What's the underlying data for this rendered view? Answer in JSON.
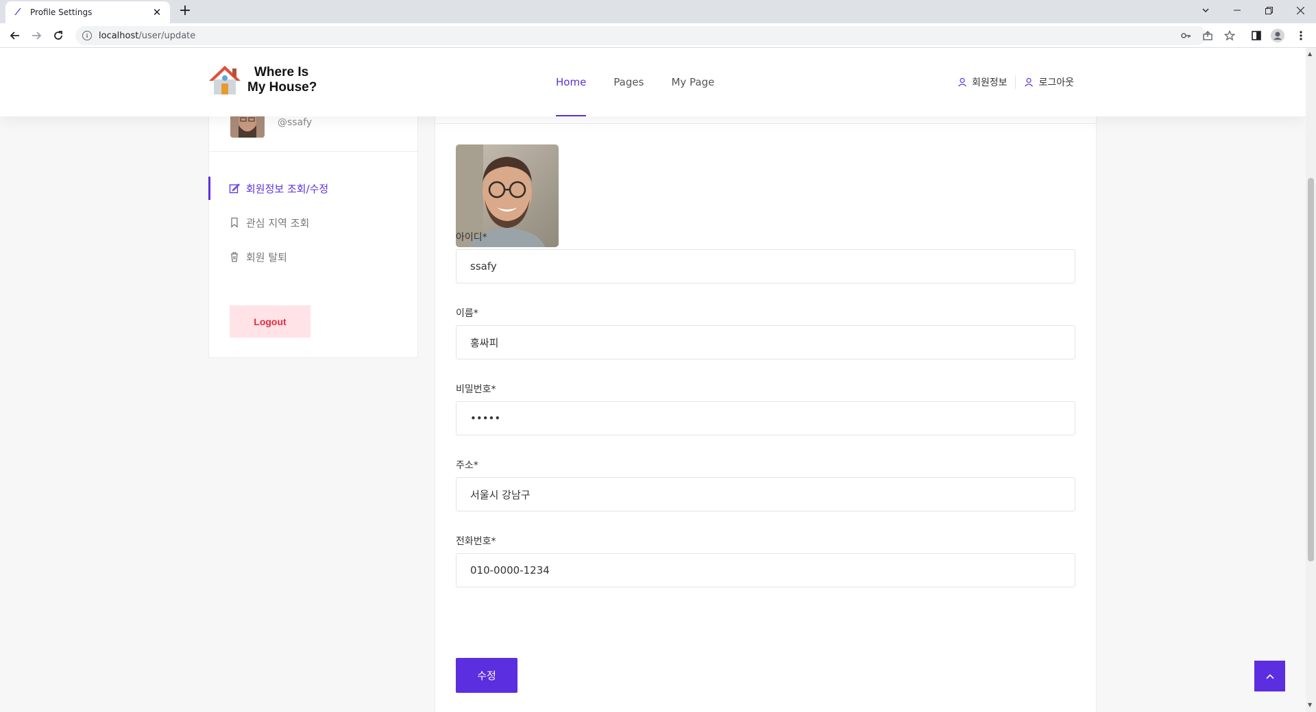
{
  "browser": {
    "tab_title": "Profile Settings",
    "tab_close": "✕",
    "new_tab": "+",
    "url_host": "localhost",
    "url_path": "/user/update"
  },
  "site": {
    "logo_line1": "Where Is",
    "logo_line2": "My House?",
    "nav": [
      {
        "label": "Home",
        "active": true
      },
      {
        "label": "Pages",
        "active": false
      },
      {
        "label": "My Page",
        "active": false
      }
    ],
    "header_links": [
      {
        "label": "회원정보"
      },
      {
        "label": "로그아웃"
      }
    ]
  },
  "sidebar": {
    "handle": "@ssafy",
    "items": [
      {
        "label": "회원정보 조회/수정",
        "icon": "edit-icon",
        "active": true
      },
      {
        "label": "관심 지역 조회",
        "icon": "bookmark-icon",
        "active": false
      },
      {
        "label": "회원 탈퇴",
        "icon": "trash-icon",
        "active": false
      }
    ],
    "logout_label": "Logout"
  },
  "form": {
    "fields": [
      {
        "label": "아이디*",
        "value": "ssafy",
        "type": "text"
      },
      {
        "label": "이름*",
        "value": "홍싸피",
        "type": "text"
      },
      {
        "label": "비밀번호*",
        "value": "•••••",
        "type": "password"
      },
      {
        "label": "주소*",
        "value": "서울시 강남구",
        "type": "text"
      },
      {
        "label": "전화번호*",
        "value": "010-0000-1234",
        "type": "text"
      }
    ],
    "submit_label": "수정"
  },
  "colors": {
    "accent": "#5b2ee0",
    "logout_bg": "#ffe3e7",
    "logout_text": "#e02d43"
  }
}
